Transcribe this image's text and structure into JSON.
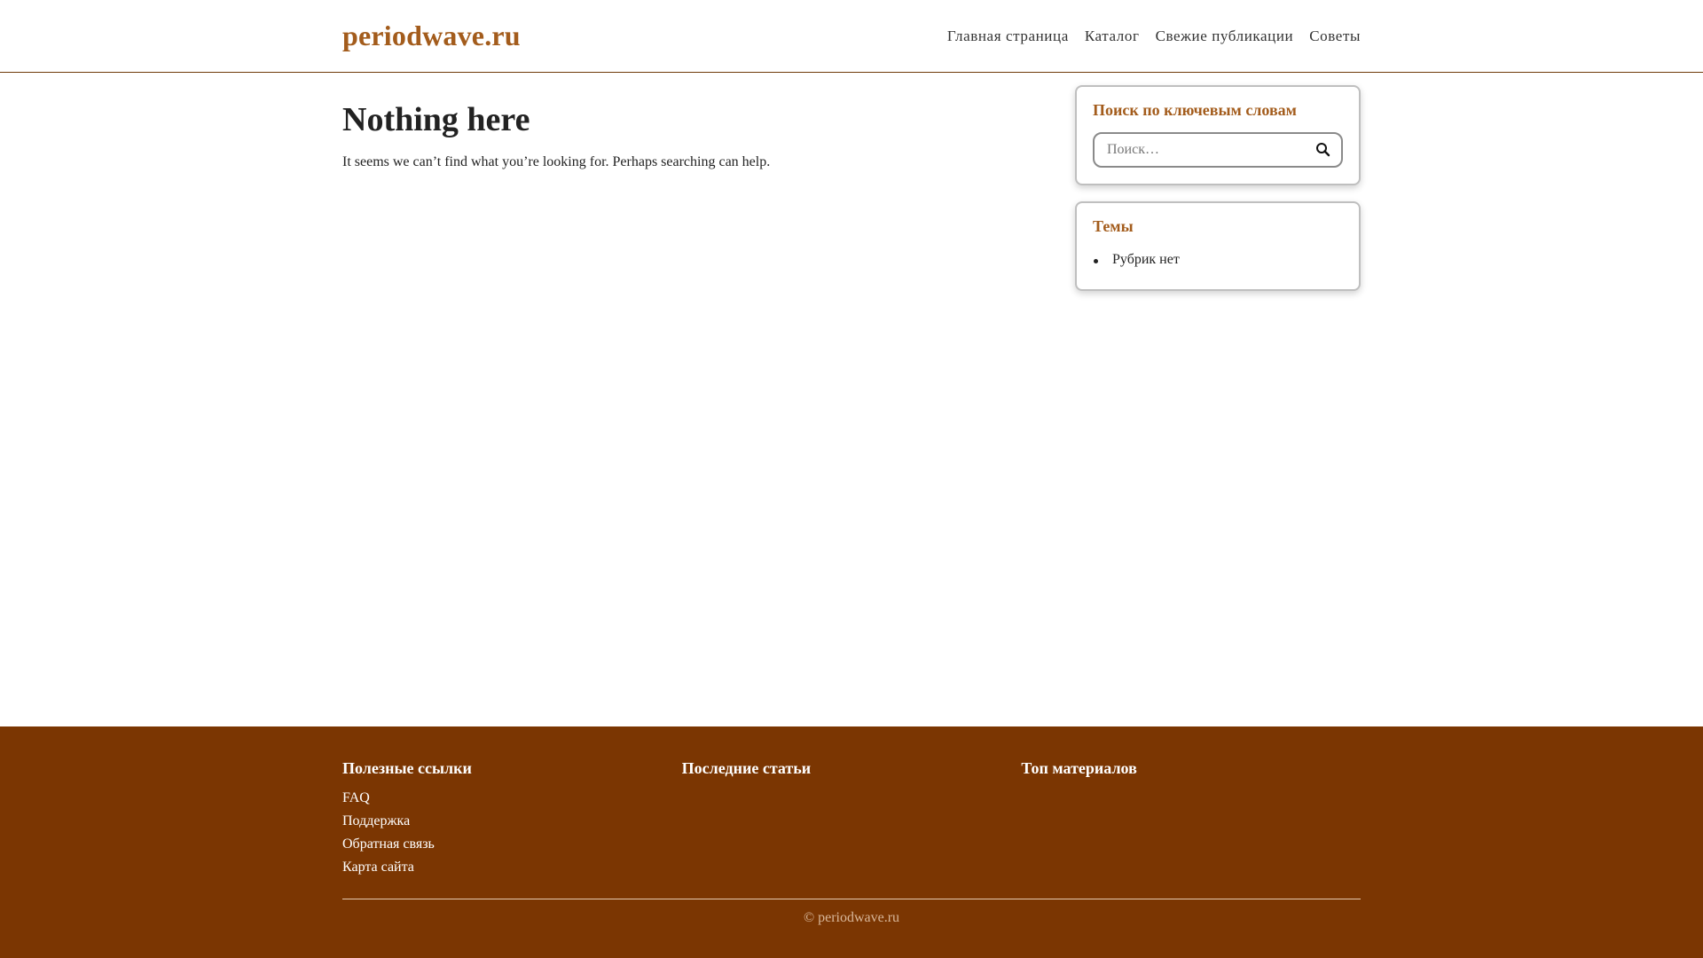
{
  "header": {
    "site_title": "periodwave.ru",
    "nav": [
      {
        "label": "Главная страница"
      },
      {
        "label": "Каталог"
      },
      {
        "label": "Свежие публикации"
      },
      {
        "label": "Советы"
      }
    ]
  },
  "main": {
    "title": "Nothing here",
    "text": "It seems we can’t find what you’re looking for. Perhaps searching can help."
  },
  "sidebar": {
    "search_widget": {
      "title": "Поиск по ключевым словам",
      "placeholder": "Поиск…",
      "icon": "search-icon"
    },
    "topics_widget": {
      "title": "Темы",
      "items": [
        "Рубрик нет"
      ]
    }
  },
  "footer": {
    "col1": {
      "title": "Полезные ссылки",
      "links": [
        "FAQ",
        "Поддержка",
        "Обратная связь",
        "Карта сайта"
      ]
    },
    "col2": {
      "title": "Последние статьи"
    },
    "col3": {
      "title": "Топ материалов"
    },
    "copyright": "© periodwave.ru"
  },
  "colors": {
    "brand": "#a35c1c",
    "footer_bg": "#7b3602"
  }
}
